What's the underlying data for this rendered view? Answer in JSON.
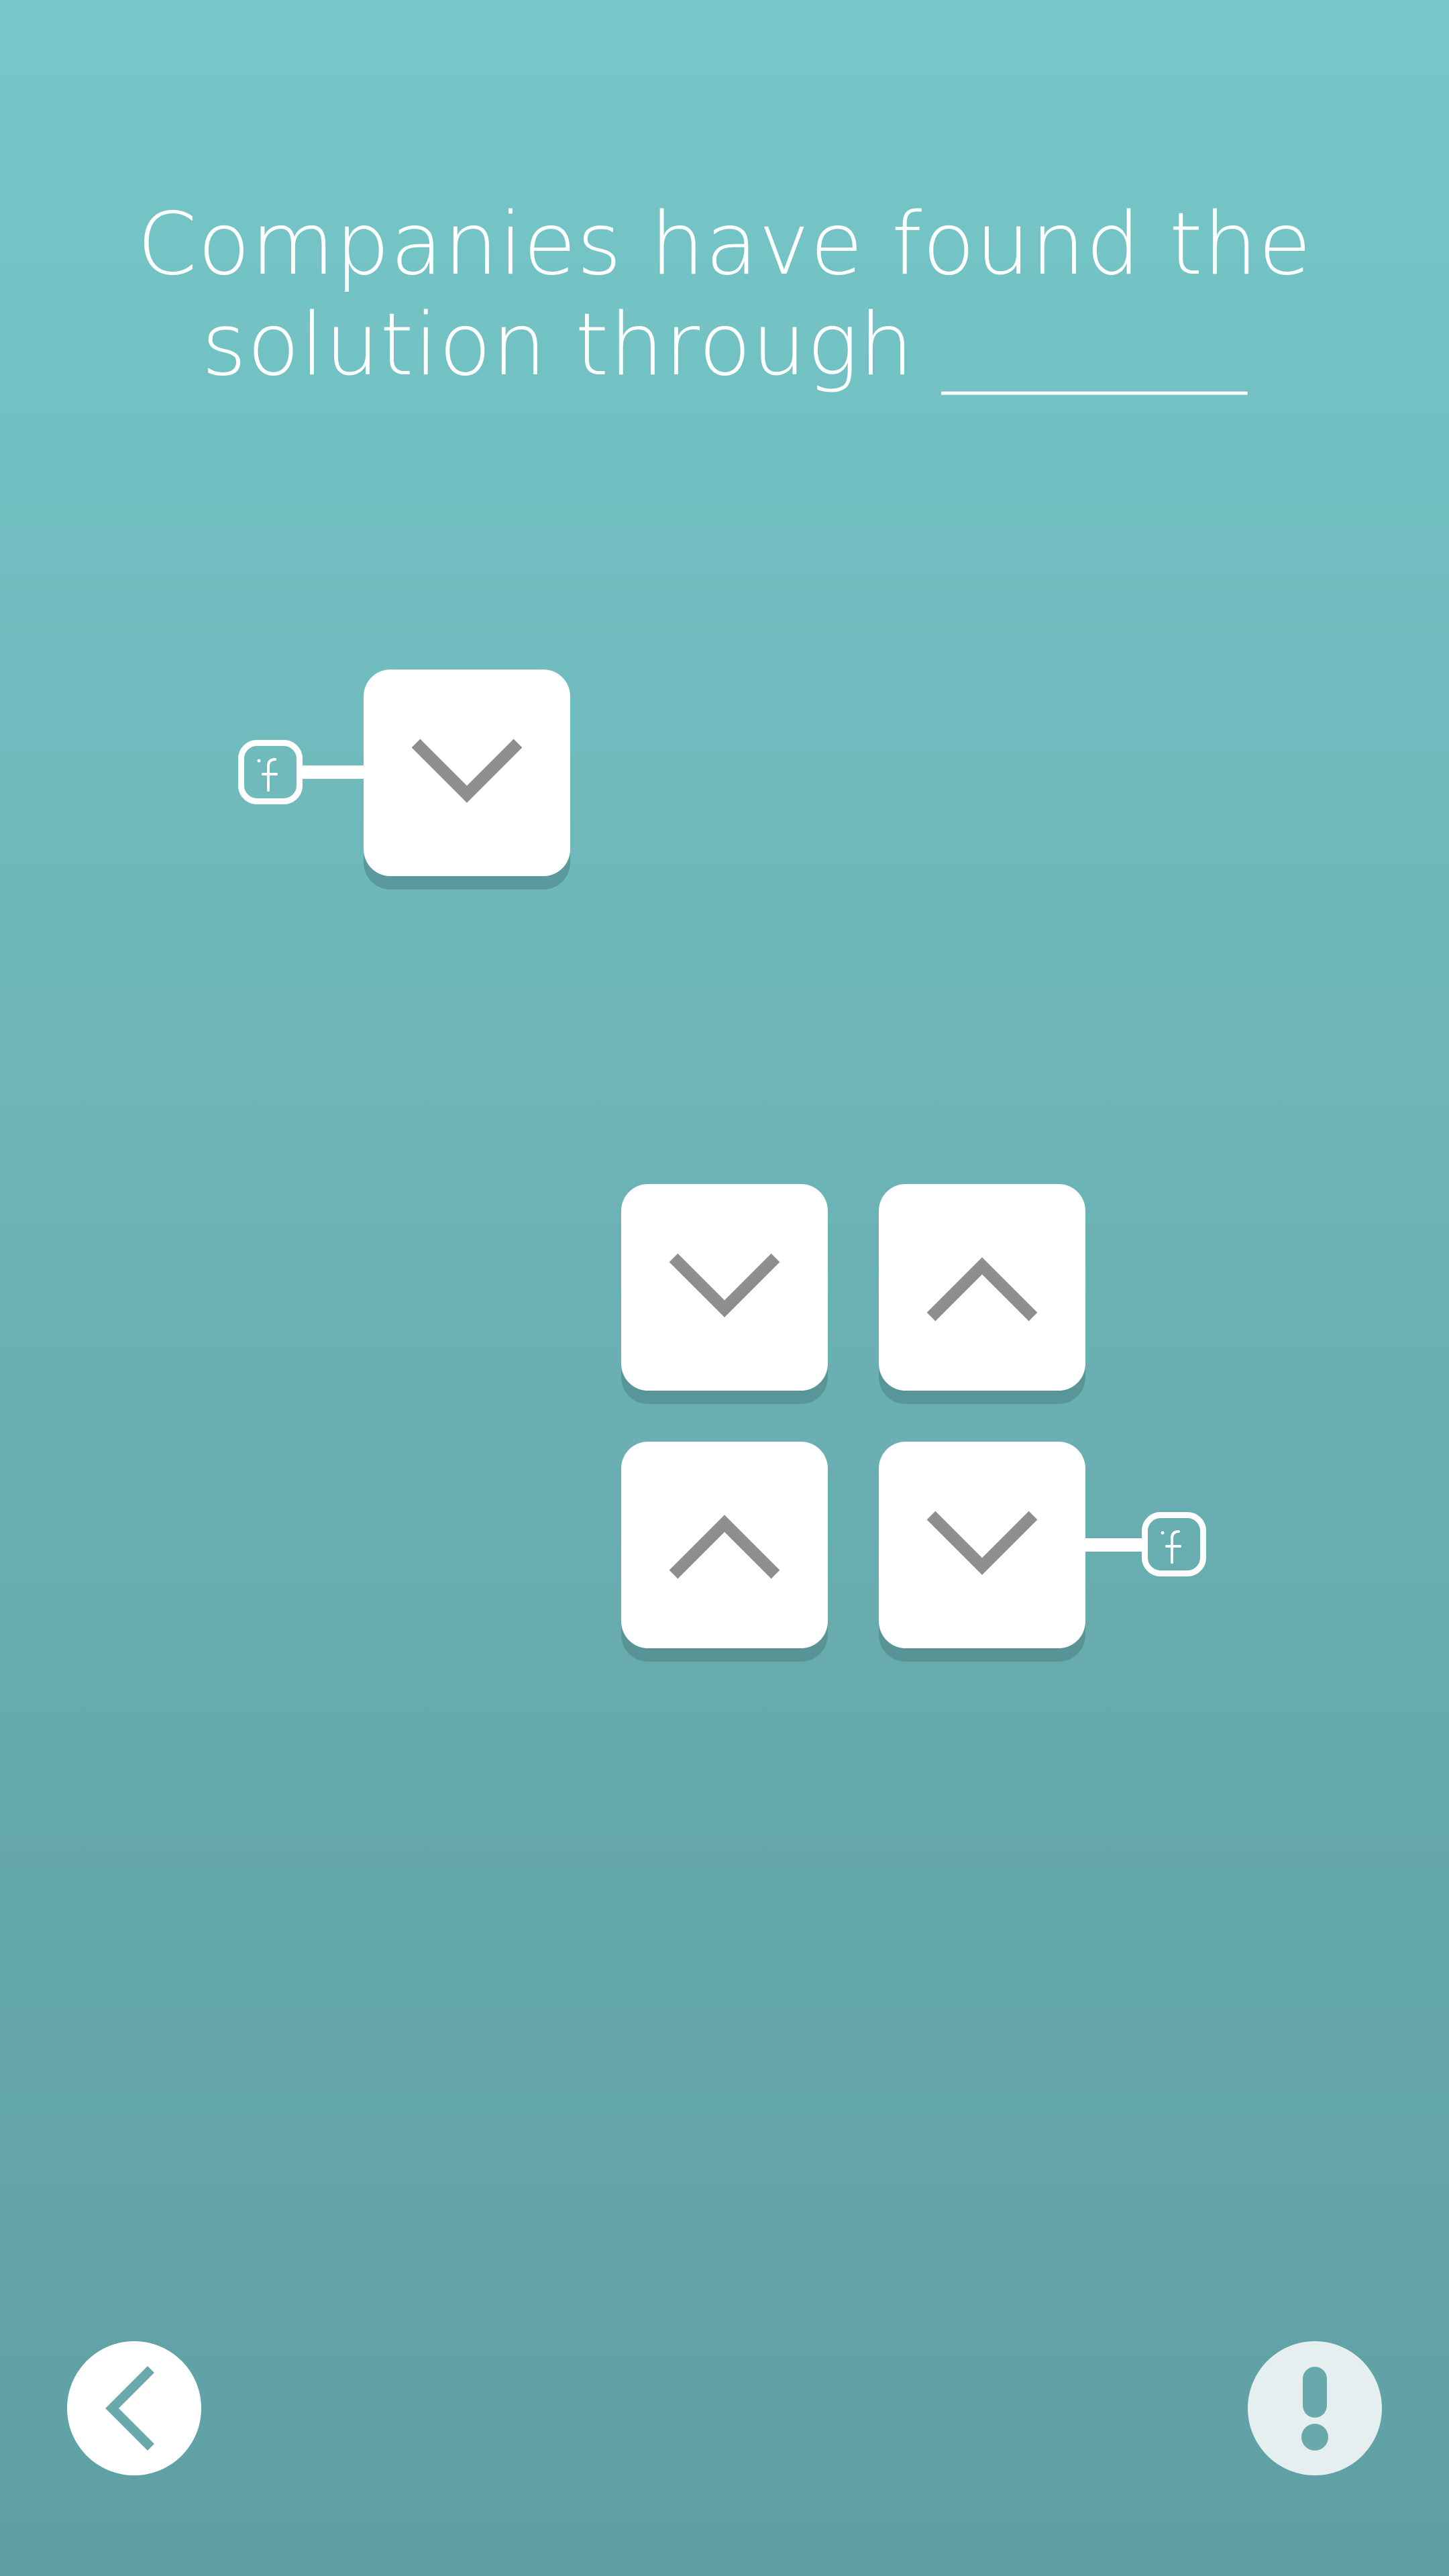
{
  "question": {
    "line1": "Companies have found the",
    "line2": "solution through _______"
  },
  "tiles": [
    {
      "direction": "down"
    },
    {
      "direction": "down"
    },
    {
      "direction": "up"
    },
    {
      "direction": "up"
    },
    {
      "direction": "down"
    }
  ],
  "nodes": [
    {
      "icon": "facebook-icon"
    },
    {
      "icon": "facebook-icon"
    }
  ],
  "buttons": {
    "back": {
      "icon": "chevron-left-icon"
    },
    "hint": {
      "icon": "exclamation-icon"
    }
  },
  "colors": {
    "background_top": "#76c8c9",
    "background_bottom": "#5fa0a4",
    "tile": "#ffffff",
    "arrow": "#8e8e8e",
    "accent_teal": "#6aa9ab"
  }
}
